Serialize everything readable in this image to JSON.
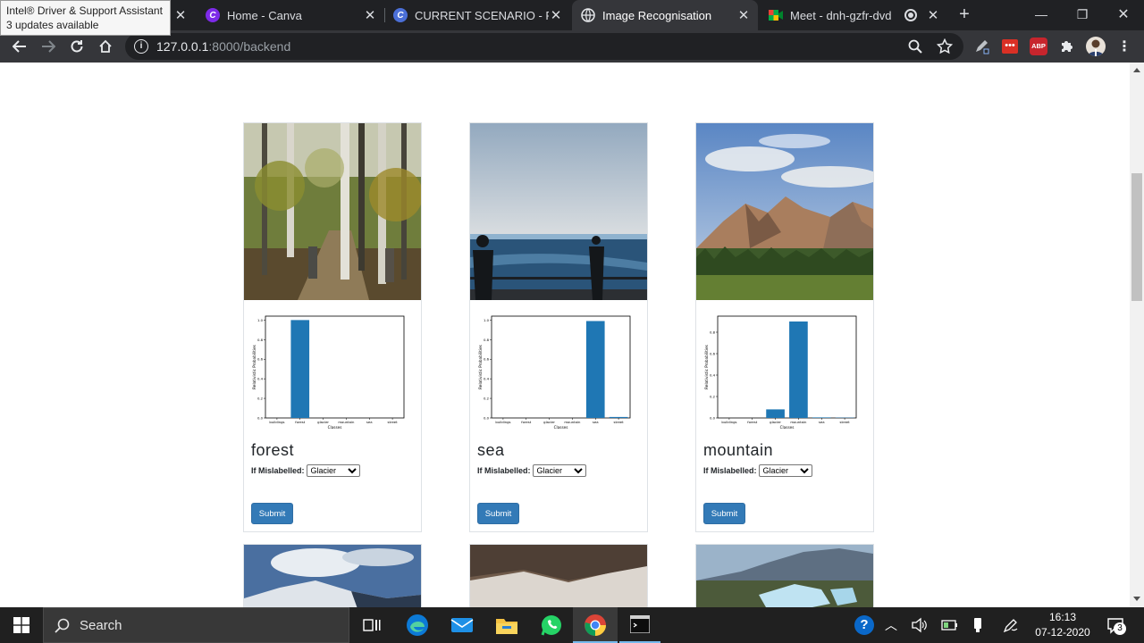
{
  "browser": {
    "tooltip": {
      "line1": "Intel® Driver & Support Assistant",
      "line2": "3 updates available"
    },
    "tabs": [
      {
        "title": "Home - Canva"
      },
      {
        "title": "CURRENT SCENARIO - Pres"
      },
      {
        "title": "Image Recognisation"
      },
      {
        "title": "Meet - dnh-gzfr-dvd"
      }
    ],
    "url_host": "127.0.0.1",
    "url_rest": ":8000/backend",
    "ext_abp": "ABP"
  },
  "page": {
    "mislabel_label": "If Mislabelled:",
    "submit_label": "Submit",
    "cards": [
      {
        "label": "forest",
        "selected": "Glacier"
      },
      {
        "label": "sea",
        "selected": "Glacier"
      },
      {
        "label": "mountain",
        "selected": "Glacier"
      }
    ]
  },
  "chart_data": [
    {
      "type": "bar",
      "categories": [
        "buildings",
        "forest",
        "glacier",
        "mountain",
        "sea",
        "street"
      ],
      "values": [
        0.0,
        1.0,
        0.0,
        0.0,
        0.0,
        0.0
      ],
      "xlabel": "Classes",
      "ylabel": "Relativistic Probabilities",
      "ylim": [
        0,
        1.04
      ],
      "yticks": [
        "0.0",
        "0.2",
        "0.4",
        "0.6",
        "0.8",
        "1.0"
      ],
      "color": "#1f77b4"
    },
    {
      "type": "bar",
      "categories": [
        "buildings",
        "forest",
        "glacier",
        "mountain",
        "sea",
        "street"
      ],
      "values": [
        0.0,
        0.0,
        0.0,
        0.0,
        0.99,
        0.01
      ],
      "xlabel": "Classes",
      "ylabel": "Relativistic Probabilities",
      "ylim": [
        0,
        1.04
      ],
      "yticks": [
        "0.0",
        "0.2",
        "0.4",
        "0.6",
        "0.8",
        "1.0"
      ],
      "color": "#1f77b4"
    },
    {
      "type": "bar",
      "categories": [
        "buildings",
        "forest",
        "glacier",
        "mountain",
        "sea",
        "street"
      ],
      "values": [
        0.0,
        0.0,
        0.08,
        0.9,
        0.005,
        0.003
      ],
      "xlabel": "Classes",
      "ylabel": "Relativistic Probabilities",
      "ylim": [
        0,
        0.95
      ],
      "yticks": [
        "0.0",
        "0.2",
        "0.4",
        "0.6",
        "0.8"
      ],
      "color": "#1f77b4"
    }
  ],
  "taskbar": {
    "search_label": "Search",
    "time": "16:13",
    "date": "07-12-2020",
    "notification_count": "3",
    "help_glyph": "?"
  }
}
